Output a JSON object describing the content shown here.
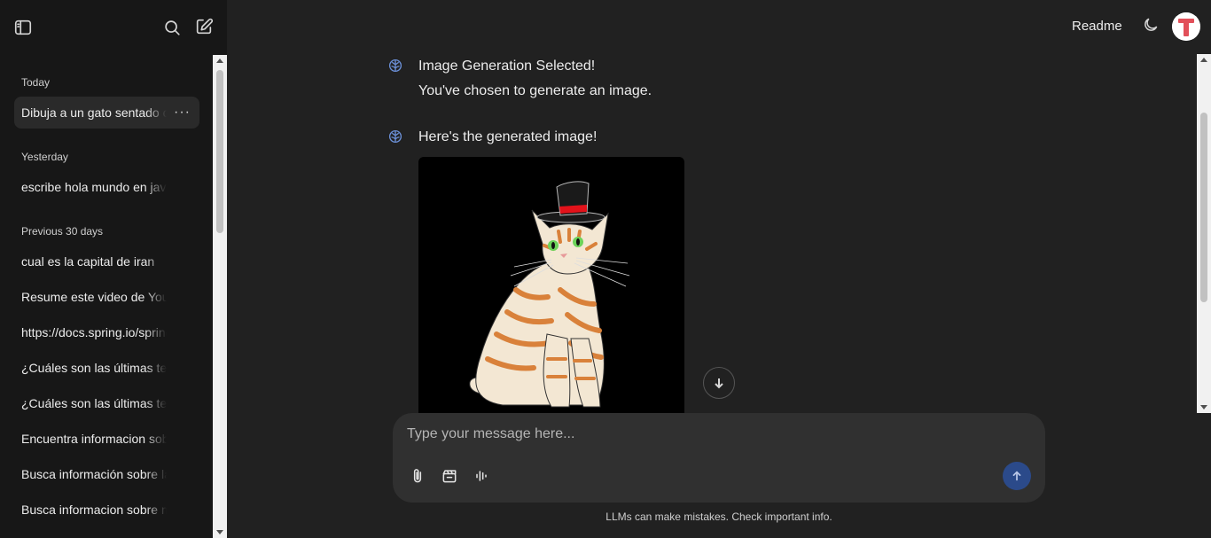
{
  "sidebar": {
    "sections": [
      {
        "title": "Today",
        "items": [
          "Dibuja a un gato sentado con sombrero"
        ]
      },
      {
        "title": "Yesterday",
        "items": [
          "escribe hola mundo en java"
        ]
      },
      {
        "title": "Previous 30 days",
        "items": [
          "cual es la capital de iran",
          "Resume este video de YouTube",
          "https://docs.spring.io/spring-ai/reference",
          "¿Cuáles son las últimas tendencias",
          "¿Cuáles son las últimas tendencias",
          "Encuentra informacion sobre RAG",
          "Busca información sobre la ética",
          "Busca informacion sobre multi agentes"
        ]
      }
    ],
    "more_label": "···"
  },
  "header": {
    "readme_label": "Readme"
  },
  "messages": [
    {
      "lines": [
        "Image Generation Selected!",
        "You've chosen to generate an image."
      ]
    },
    {
      "lines": [
        "Here's the generated image!"
      ]
    }
  ],
  "composer": {
    "placeholder": "Type your message here...",
    "disclaimer": "LLMs can make mistakes. Check important info."
  },
  "colors": {
    "background": "#212121",
    "sidebar": "#171717",
    "composer": "#303030",
    "send_button": "#2b4a8a",
    "assistant_icon": "#6b8fd6"
  }
}
